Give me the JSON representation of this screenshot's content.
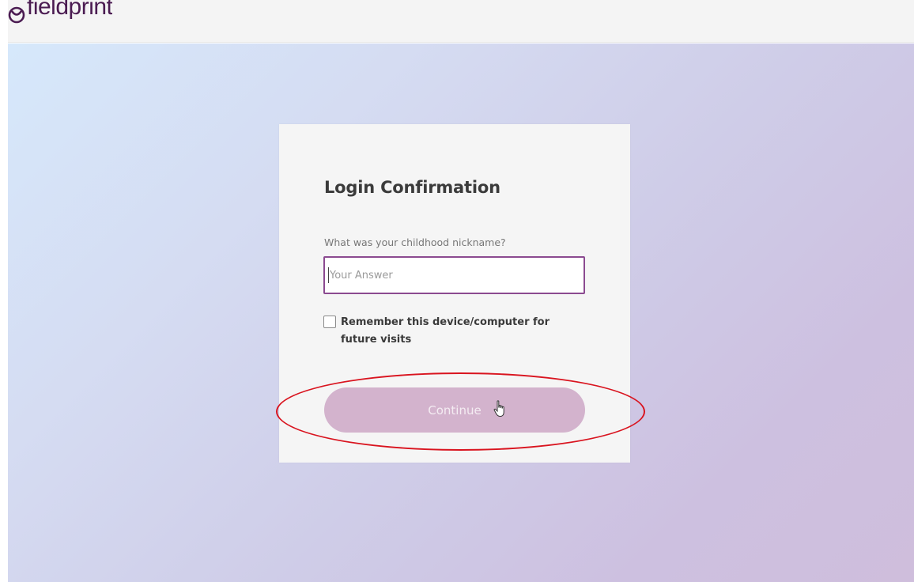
{
  "header": {
    "logo_text": "fieldprint",
    "logo_icon": "fieldprint-logo-icon"
  },
  "card": {
    "title": "Login Confirmation",
    "question": "What was your childhood nickname?",
    "answer_placeholder": "Your Answer",
    "answer_value": "",
    "remember_label": "Remember this device/computer for future visits",
    "remember_checked": false,
    "continue_label": "Continue"
  },
  "annotation": {
    "highlight_color": "#d9141f",
    "highlight_target": "continue-button"
  },
  "colors": {
    "brand": "#4b1c52",
    "input_border": "#8b4a90",
    "button_bg": "#d3b3cd"
  }
}
